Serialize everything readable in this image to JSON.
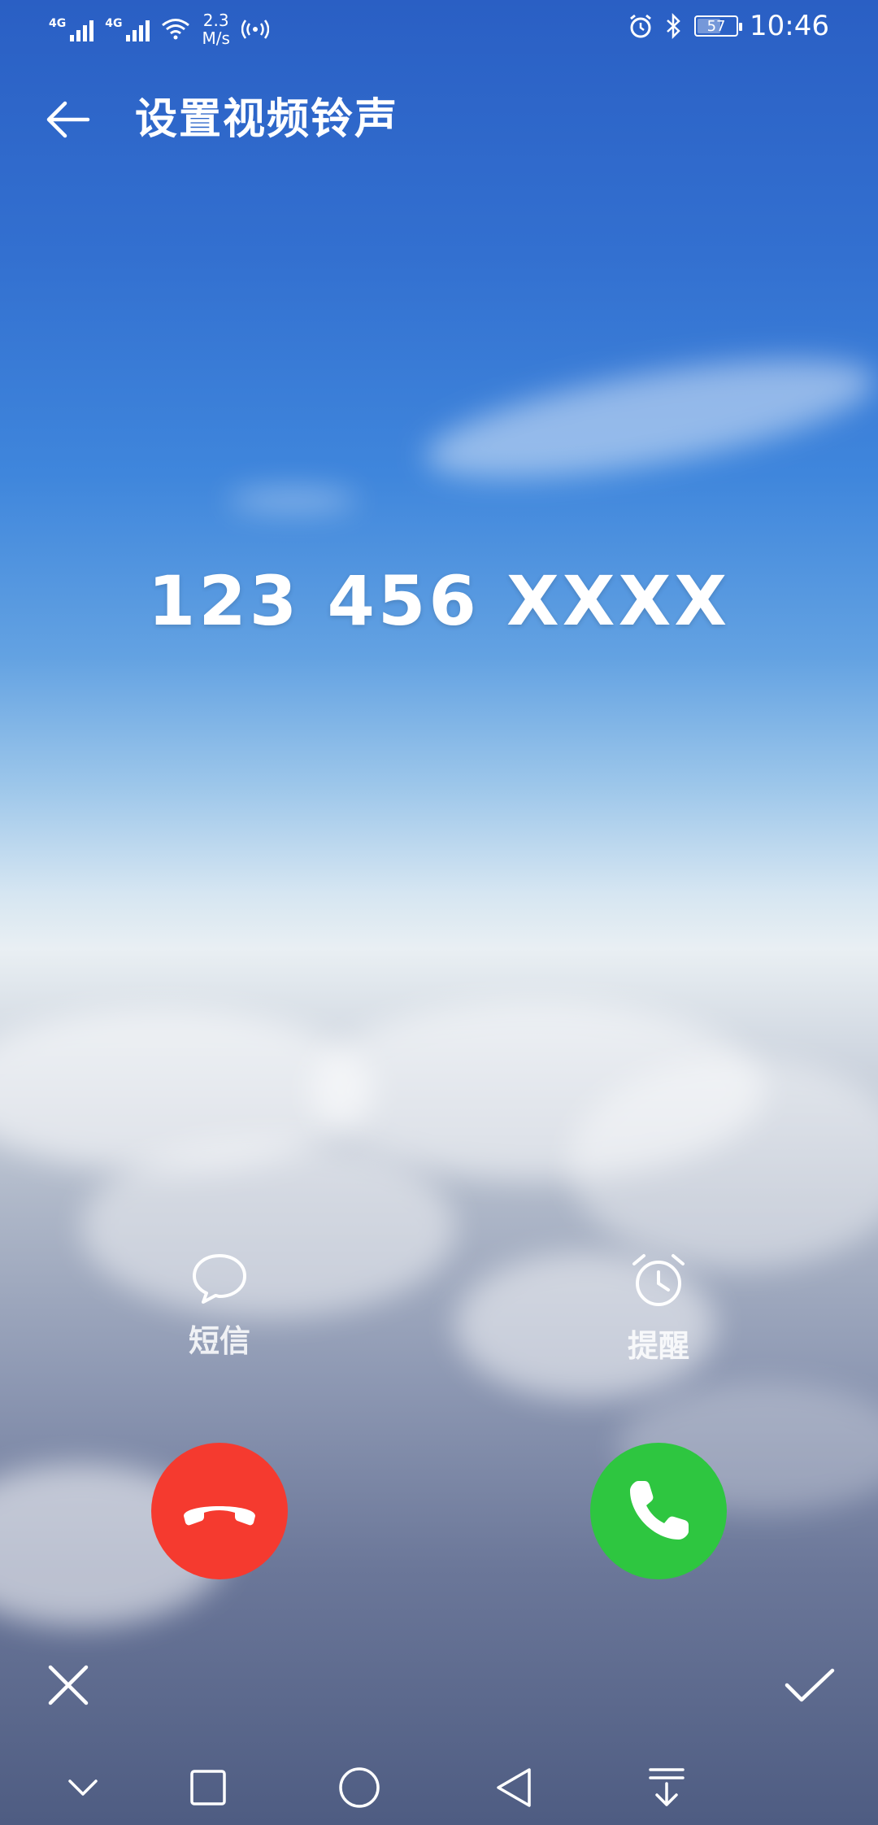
{
  "status_bar": {
    "signal1_label": "4G",
    "signal2_label": "4G",
    "speed_value": "2.3",
    "speed_unit": "M/s",
    "battery_level": "57",
    "time": "10:46"
  },
  "header": {
    "title": "设置视频铃声"
  },
  "call": {
    "number": "123 456 XXXX"
  },
  "quick_actions": {
    "message_label": "短信",
    "reminder_label": "提醒"
  },
  "colors": {
    "decline": "#f53a2f",
    "answer": "#2ec640",
    "sky_top": "#2a5fc4"
  },
  "icons": {
    "back": "arrow-left-icon",
    "message": "chat-bubble-icon",
    "reminder": "alarm-clock-icon",
    "decline": "phone-hangup-icon",
    "answer": "phone-icon",
    "cancel": "close-icon",
    "confirm": "check-icon"
  }
}
